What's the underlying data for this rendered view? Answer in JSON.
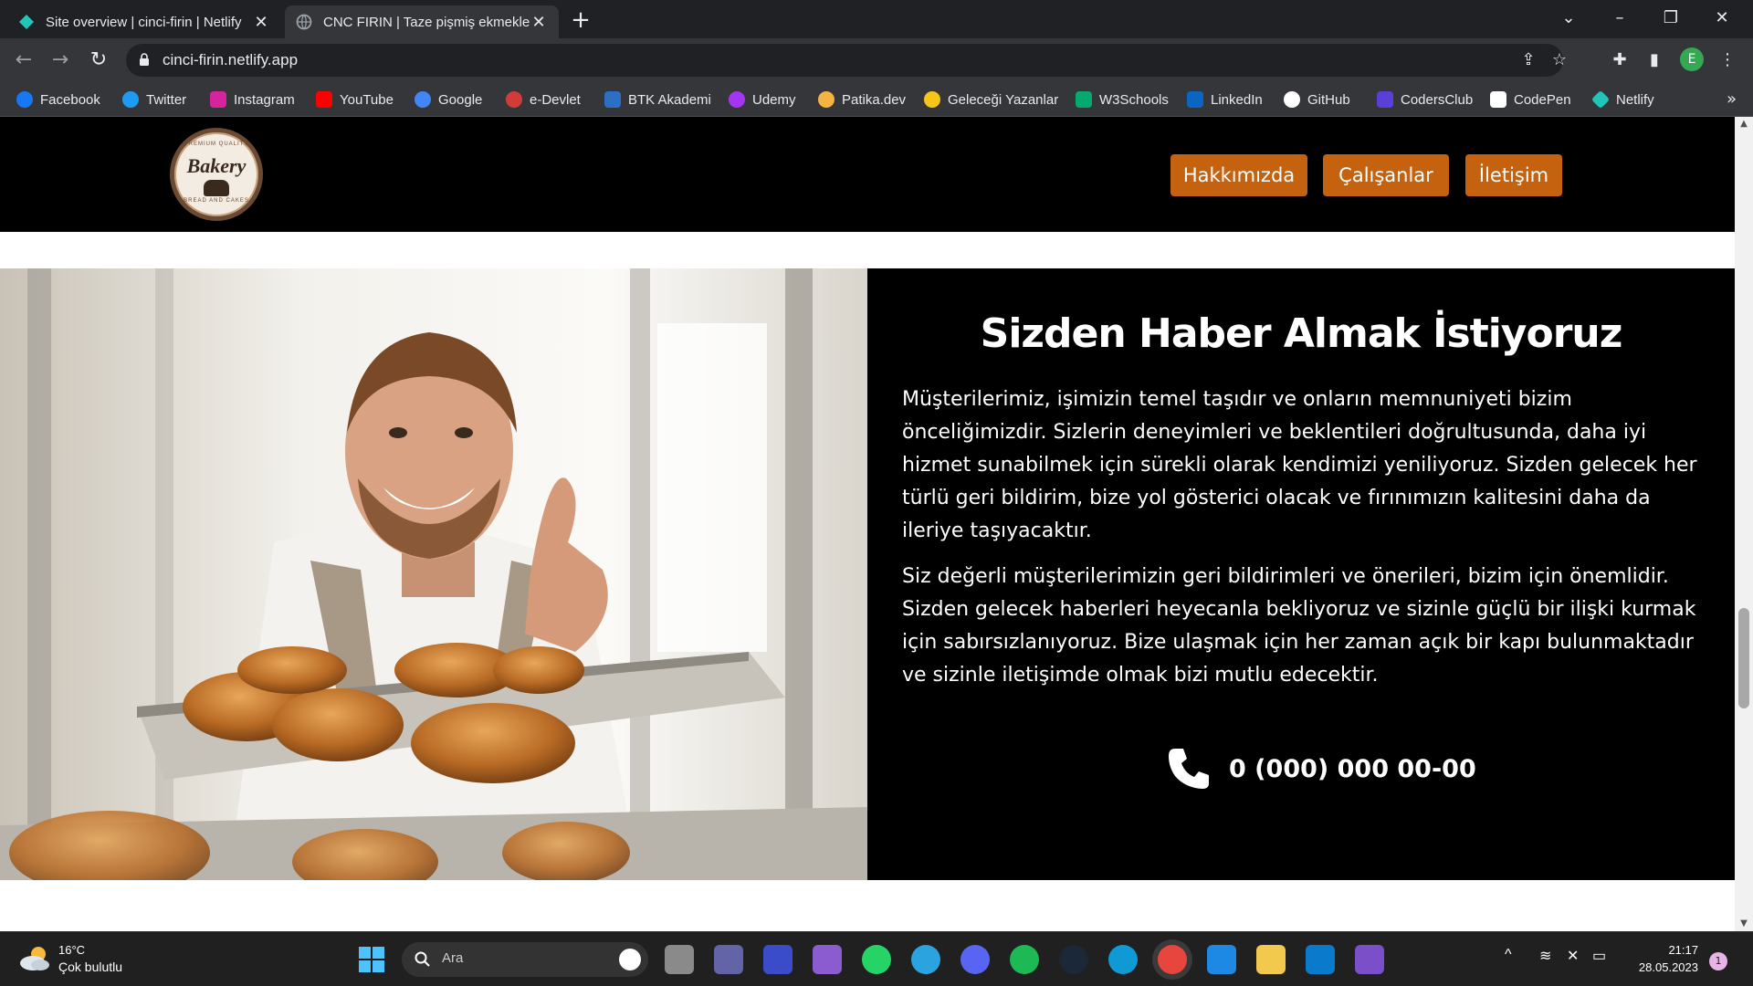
{
  "browser": {
    "tabs": [
      {
        "title": "Site overview | cinci-firin | Netlify",
        "active": false,
        "icon": "netlify-icon"
      },
      {
        "title": "CNC FIRIN | Taze pişmiş ekmekler",
        "active": true,
        "icon": "globe-icon"
      }
    ],
    "url": "cinci-firin.netlify.app",
    "profile_initial": "E",
    "bookmarks": [
      {
        "label": "Facebook",
        "color": "#1877f2"
      },
      {
        "label": "Twitter",
        "color": "#1d9bf0"
      },
      {
        "label": "Instagram",
        "color": "#d6249f"
      },
      {
        "label": "YouTube",
        "color": "#ff0000"
      },
      {
        "label": "Google",
        "color": "#4285f4"
      },
      {
        "label": "e-Devlet",
        "color": "#d33b3b"
      },
      {
        "label": "BTK Akademi",
        "color": "#2d6fc4"
      },
      {
        "label": "Udemy",
        "color": "#a435f0"
      },
      {
        "label": "Patika.dev",
        "color": "#f5b342"
      },
      {
        "label": "Geleceği Yazanlar",
        "color": "#f5c518"
      },
      {
        "label": "W3Schools",
        "color": "#04aa6d"
      },
      {
        "label": "LinkedIn",
        "color": "#0a66c2"
      },
      {
        "label": "GitHub",
        "color": "#ffffff"
      },
      {
        "label": "CodersClub",
        "color": "#5a3fd8"
      },
      {
        "label": "CodePen",
        "color": "#ffffff"
      },
      {
        "label": "Netlify",
        "color": "#20c6b7"
      }
    ],
    "bookmarks_more": "»"
  },
  "site": {
    "logo": {
      "top": "PREMIUM QUALITY",
      "main": "Bakery",
      "bottom": "BREAD AND CAKES"
    },
    "nav": [
      {
        "label": "Hakkımızda"
      },
      {
        "label": "Çalışanlar"
      },
      {
        "label": "İletişim"
      }
    ],
    "accent": "#c4620f",
    "contact": {
      "heading": "Sizden Haber Almak İstiyoruz",
      "paragraph1": "Müşterilerimiz, işimizin temel taşıdır ve onların memnuniyeti bizim önceliğimizdir. Sizlerin deneyimleri ve beklentileri doğrultusunda, daha iyi hizmet sunabilmek için sürekli olarak kendimizi yeniliyoruz. Sizden gelecek her türlü geri bildirim, bize yol gösterici olacak ve fırınımızın kalitesini daha da ileriye taşıyacaktır.",
      "paragraph2": "Siz değerli müşterilerimizin geri bildirimleri ve önerileri, bizim için önemlidir. Sizden gelecek haberleri heyecanla bekliyoruz ve sizinle güçlü bir ilişki kurmak için sabırsızlanıyoruz. Bize ulaşmak için her zaman açık bir kapı bulunmaktadır ve sizinle iletişimde olmak bizi mutlu edecektir.",
      "phone": "0 (000) 000 00-00"
    }
  },
  "taskbar": {
    "weather": {
      "temp": "16°C",
      "desc": "Çok bulutlu"
    },
    "search_placeholder": "Ara",
    "time": "21:17",
    "date": "28.05.2023",
    "notifications": "1"
  }
}
